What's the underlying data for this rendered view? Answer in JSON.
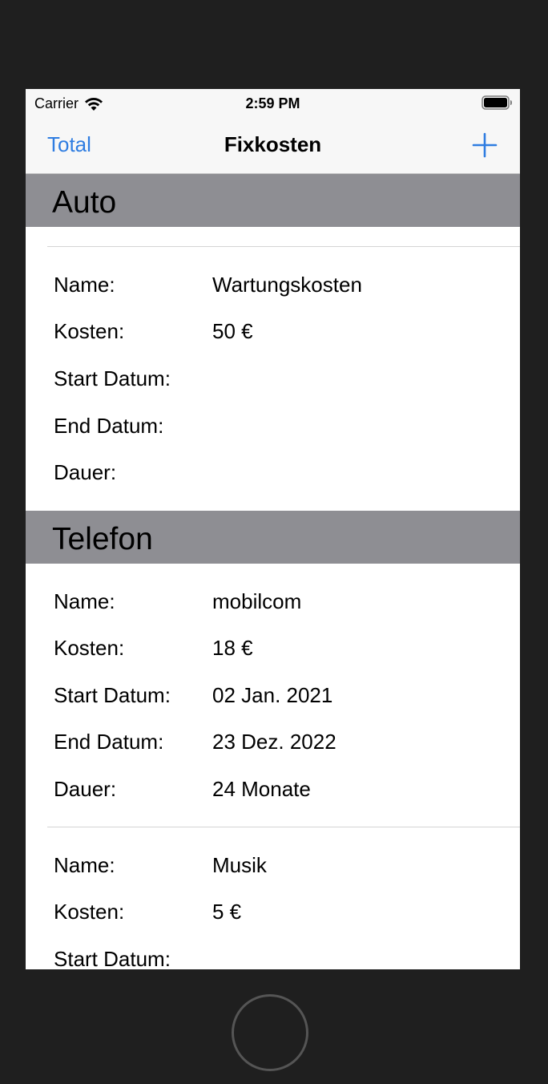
{
  "status_bar": {
    "carrier": "Carrier",
    "time": "2:59 PM"
  },
  "nav": {
    "left_button": "Total",
    "title": "Fixkosten",
    "add_icon": "plus-icon"
  },
  "colors": {
    "accent": "#2f7de1",
    "section_header_bg": "#8e8e93",
    "nav_bg": "#f7f7f7",
    "device_bezel": "#1f1f1f"
  },
  "sections": [
    {
      "title": "Auto",
      "items": [
        {
          "name_label": "Name:",
          "name": "Wartungskosten",
          "cost_label": "Kosten:",
          "cost": "50 €",
          "start_label": "Start Datum:",
          "start": "",
          "end_label": "End Datum:",
          "end": "",
          "duration_label": "Dauer:",
          "duration": ""
        }
      ]
    },
    {
      "title": "Telefon",
      "items": [
        {
          "name_label": "Name:",
          "name": "mobilcom",
          "cost_label": "Kosten:",
          "cost": "18 €",
          "start_label": "Start Datum:",
          "start": "02 Jan. 2021",
          "end_label": "End Datum:",
          "end": "23 Dez. 2022",
          "duration_label": "Dauer:",
          "duration": "24 Monate"
        },
        {
          "name_label": "Name:",
          "name": "Musik",
          "cost_label": "Kosten:",
          "cost": "5 €",
          "start_label": "Start Datum:",
          "start": ""
        }
      ]
    }
  ]
}
